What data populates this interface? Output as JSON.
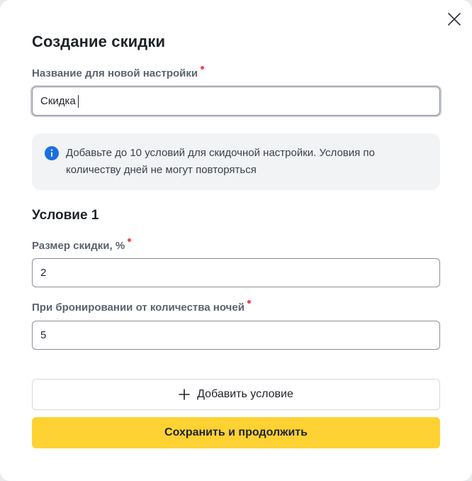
{
  "dialog": {
    "title": "Создание скидки",
    "close_icon": "close-icon"
  },
  "name_field": {
    "label": "Название для новой настройки",
    "value": "Скидка",
    "required": true
  },
  "info_banner": {
    "icon": "info-icon",
    "icon_color": "#1a6fe0",
    "text": "Добавьте до 10 условий для скидочной настройки. Условия по количеству дней не могут повторяться"
  },
  "condition": {
    "title": "Условие 1",
    "discount": {
      "label": "Размер скидки, %",
      "value": "2",
      "required": true
    },
    "nights": {
      "label": "При бронировании от количества ночей",
      "value": "5",
      "required": true
    }
  },
  "actions": {
    "add_icon": "plus-icon",
    "add_label": "Добавить условие",
    "save_label": "Сохранить и продолжить",
    "save_color": "#ffd233"
  },
  "colors": {
    "required_dot": "#f0484a"
  }
}
